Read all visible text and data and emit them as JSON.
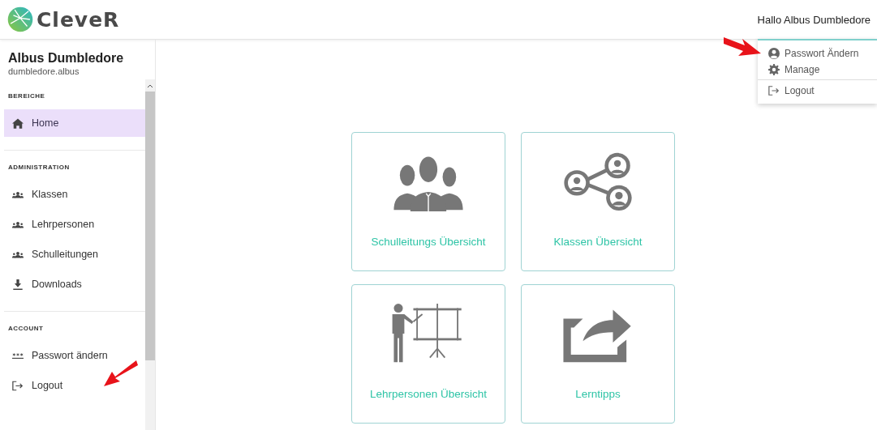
{
  "header": {
    "logo_text": "CleveR",
    "greeting": "Hallo Albus Dumbledore"
  },
  "user_menu": {
    "items": [
      {
        "kind": "account",
        "label": "Passwort Ändern"
      },
      {
        "kind": "settings",
        "label": "Manage"
      },
      {
        "kind": "logout",
        "label": "Logout"
      }
    ]
  },
  "sidebar": {
    "user_name": "Albus Dumbledore",
    "username": "dumbledore.albus",
    "sections": [
      {
        "title": "BEREICHE",
        "items": [
          {
            "kind": "home",
            "label": "Home",
            "selected": true
          }
        ]
      },
      {
        "title": "ADMINISTRATION",
        "items": [
          {
            "kind": "group",
            "label": "Klassen",
            "selected": false
          },
          {
            "kind": "group",
            "label": "Lehrpersonen",
            "selected": false
          },
          {
            "kind": "group",
            "label": "Schulleitungen",
            "selected": false
          },
          {
            "kind": "download",
            "label": "Downloads",
            "selected": false
          }
        ]
      },
      {
        "title": "ACCOUNT",
        "items": [
          {
            "kind": "password",
            "label": "Passwort ändern",
            "selected": false
          },
          {
            "kind": "logout",
            "label": "Logout",
            "selected": false
          }
        ]
      }
    ]
  },
  "tiles": [
    {
      "kind": "leaders",
      "label": "Schulleitungs Übersicht"
    },
    {
      "kind": "classes",
      "label": "Klassen Übersicht"
    },
    {
      "kind": "teacher",
      "label": "Lehrpersonen Übersicht"
    },
    {
      "kind": "share",
      "label": "Lerntipps"
    }
  ]
}
